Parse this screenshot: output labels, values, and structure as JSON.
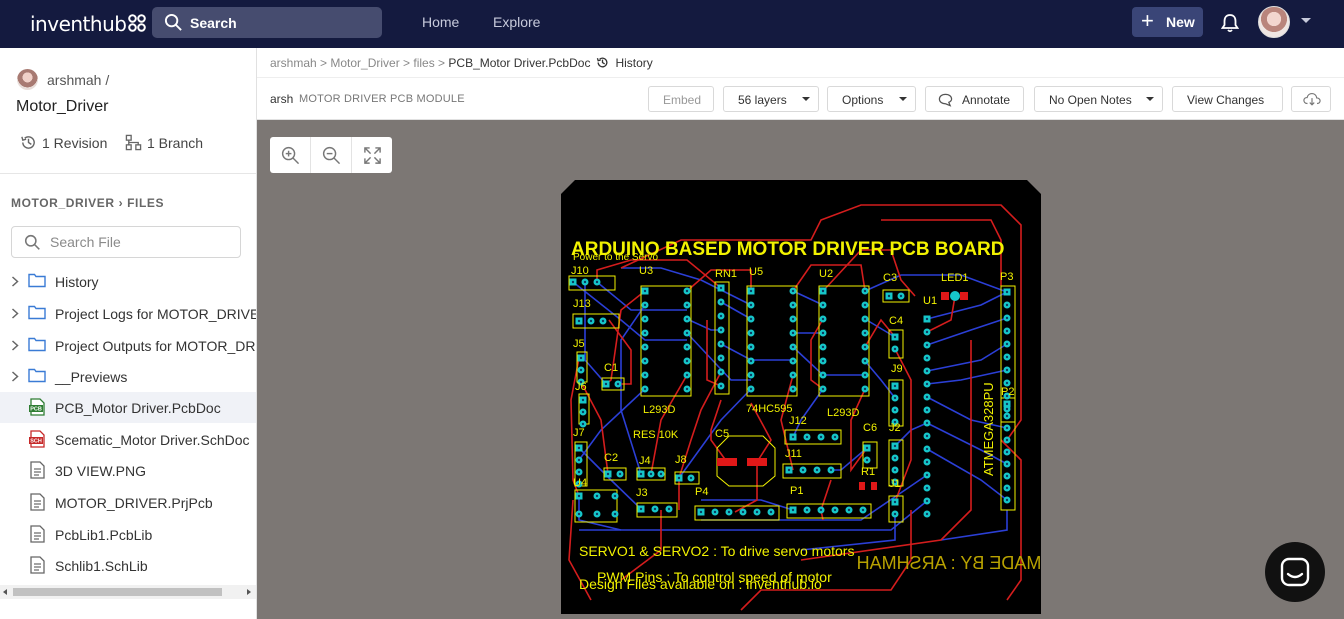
{
  "nav": {
    "logo": "inventhub",
    "search_label": "Search",
    "home": "Home",
    "explore": "Explore",
    "new_label": "New"
  },
  "sidebar": {
    "owner": "arshmah /",
    "repo": "Motor_Driver",
    "revisions": "1 Revision",
    "branches": "1 Branch",
    "breadcrumb": "MOTOR_DRIVER  ›  FILES",
    "search_placeholder": "Search File",
    "items": [
      {
        "label": "History",
        "kind": "folder"
      },
      {
        "label": "Project Logs for MOTOR_DRIVER",
        "kind": "folder"
      },
      {
        "label": "Project Outputs for MOTOR_DRIVER",
        "kind": "folder"
      },
      {
        "label": "__Previews",
        "kind": "folder"
      },
      {
        "label": "PCB_Motor Driver.PcbDoc",
        "kind": "pcb"
      },
      {
        "label": "Scematic_Motor Driver.SchDoc",
        "kind": "sch"
      },
      {
        "label": "3D VIEW.PNG",
        "kind": "file"
      },
      {
        "label": "MOTOR_DRIVER.PrjPcb",
        "kind": "file"
      },
      {
        "label": "PcbLib1.PcbLib",
        "kind": "file"
      },
      {
        "label": "Schlib1.SchLib",
        "kind": "file"
      }
    ]
  },
  "header": {
    "path": "arshmah > Motor_Driver > files > ",
    "current_file": "PCB_Motor Driver.PcbDoc",
    "history": "History",
    "doc_owner": "arsh",
    "doc_desc": "MOTOR DRIVER PCB MODULE",
    "embed": "Embed",
    "layers": "56 layers",
    "options": "Options",
    "annotate": "Annotate",
    "notes": "No Open Notes",
    "view_changes": "View Changes"
  },
  "pcb": {
    "title": "ARDUINO BASED MOTOR DRIVER PCB BOARD",
    "servo_note": "Power to the Servo",
    "refs": [
      "J10",
      "U3",
      "RN1",
      "U5",
      "U2",
      "C3",
      "LED1",
      "P3",
      "J13",
      "U1",
      "J5",
      "C4",
      "C1",
      "J9",
      "J6",
      "L293D",
      "74HC595",
      "L293D",
      "RES 10K",
      "C5",
      "J12",
      "C6",
      "P2",
      "J7",
      "J2",
      "J4",
      "J8",
      "J11",
      "C2",
      "R1",
      "U4",
      "J3",
      "P4",
      "P1",
      "J1",
      "ATMEGA328PU"
    ],
    "note1": "SERVO1 & SERVO2 : To drive servo motors",
    "note2": "PWM Pins : To control speed of motor",
    "note3": "Design Files available on : inventhub.io",
    "mirrored": "MADE BY : ARSHMAH"
  },
  "colors": {
    "nav_bg": "#141a3f",
    "board": "#000000",
    "top_trace": "#d41d1d",
    "bottom_trace": "#2b3fd6",
    "silkscreen": "#f2f200",
    "pad": "#16c6c9"
  }
}
